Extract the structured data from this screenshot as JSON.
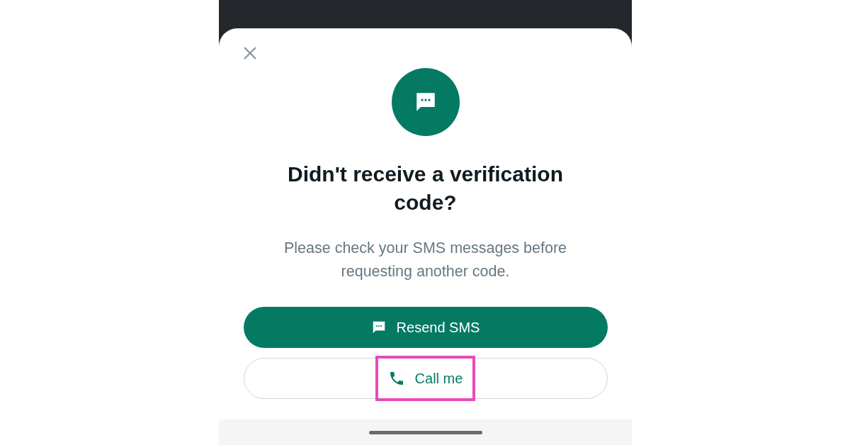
{
  "dialog": {
    "title": "Didn't receive a verification code?",
    "message": "Please check your SMS messages before requesting another code."
  },
  "buttons": [
    {
      "label": "Resend SMS",
      "kind": "filled",
      "highlighted": false
    },
    {
      "label": "Call me",
      "kind": "outlined",
      "highlighted": true
    }
  ]
}
